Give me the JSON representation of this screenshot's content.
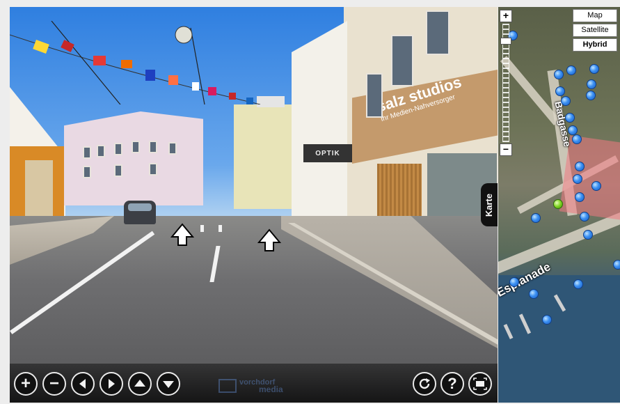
{
  "panorama": {
    "storefront_sign": "salz studios",
    "storefront_subtitle": "Ihr Medien-Nahversorger",
    "optik_sign": "OPTIK"
  },
  "nav_arrows": [
    {
      "name": "nav-arrow-left"
    },
    {
      "name": "nav-arrow-right"
    }
  ],
  "controls": {
    "zoom_in": "+",
    "zoom_out": "−",
    "brand_line1": "vorchdorf",
    "brand_line2": "media",
    "help": "?"
  },
  "map": {
    "types": [
      "Map",
      "Satellite",
      "Hybrid"
    ],
    "active_type": "Hybrid",
    "tab_label": "Karte",
    "street_labels": [
      "Badgasse",
      "Esplanade"
    ],
    "zoom_in": "+",
    "zoom_out": "−"
  },
  "colors": {
    "control_bg": "#111111",
    "marker_blue": "#3a8ff2",
    "marker_current": "#7ed321"
  }
}
